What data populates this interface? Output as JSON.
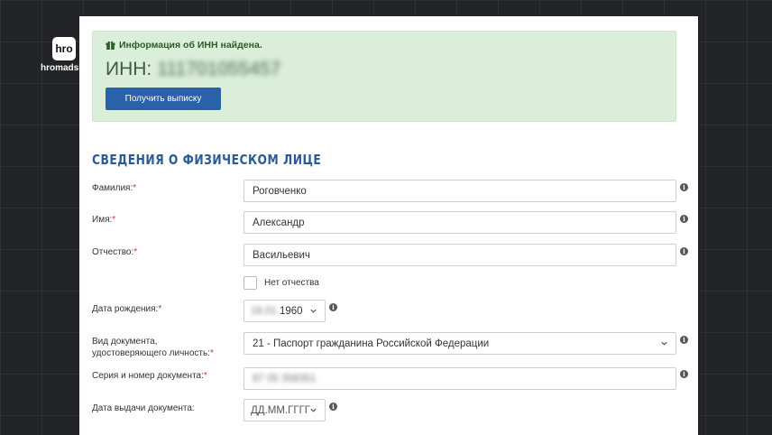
{
  "watermark": {
    "logo": "hro",
    "name": "hromadsk"
  },
  "alert": {
    "title": "Информация об ИНН найдена.",
    "inn_label": "ИНН:",
    "inn_value": "111701055457",
    "button_label": "Получить выписку"
  },
  "section": {
    "title": "СВЕДЕНИЯ О ФИЗИЧЕСКОМ ЛИЦЕ"
  },
  "fields": {
    "surname": {
      "label": "Фамилия:",
      "value": "Роговченко"
    },
    "name": {
      "label": "Имя:",
      "value": "Александр"
    },
    "patronymic": {
      "label": "Отчество:",
      "value": "Васильевич"
    },
    "no_patronymic": {
      "label": "Нет отчества",
      "checked": false
    },
    "birth_date": {
      "label": "Дата рождения:",
      "day_month": "16.01.",
      "year": "1960"
    },
    "doc_type": {
      "label_line1": "Вид документа,",
      "label_line2": "удостоверяющего личность:",
      "value": "21 - Паспорт гражданина Российской Федерации"
    },
    "doc_number": {
      "label": "Серия и номер документа:",
      "value": "87 05 358351"
    },
    "issue_date": {
      "label": "Дата выдачи документа:",
      "placeholder": "ДД.ММ.ГГГГ"
    }
  },
  "required_mark": "*",
  "info_glyph": "i",
  "colors": {
    "accent": "#2b61a9",
    "alert_bg": "#dbeeda",
    "required": "#d9302c",
    "title": "#2b5a96"
  }
}
